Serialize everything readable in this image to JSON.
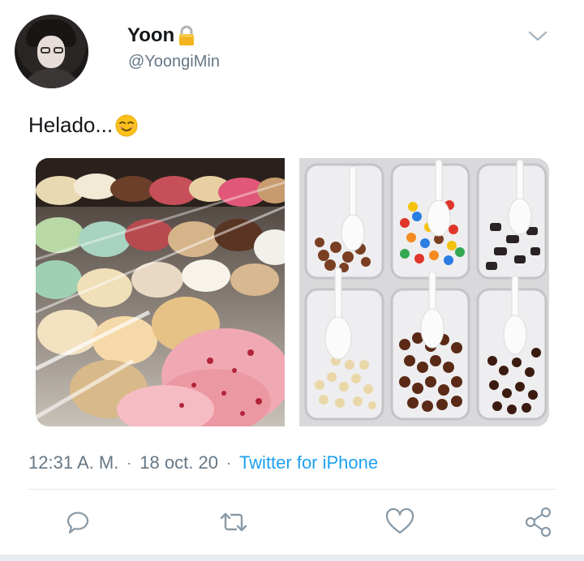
{
  "author": {
    "display_name": "Yoon",
    "handle": "@YoongiMin",
    "protected_icon": "lock-icon",
    "avatar_icon": "profile-photo"
  },
  "menu": {
    "icon": "chevron-down-icon"
  },
  "tweet": {
    "text": "Helado...",
    "emoji": "relieved-face-emoji"
  },
  "media": [
    {
      "name": "ice-cream-gelato-display-photo"
    },
    {
      "name": "toppings-bins-photo"
    }
  ],
  "meta": {
    "time": "12:31 A. M.",
    "separator": "·",
    "date": "18 oct. 20",
    "source": "Twitter for iPhone"
  },
  "actions": [
    {
      "name": "reply-button",
      "icon": "comment-icon"
    },
    {
      "name": "retweet-button",
      "icon": "retweet-icon"
    },
    {
      "name": "like-button",
      "icon": "heart-icon"
    },
    {
      "name": "share-button",
      "icon": "share-icon"
    }
  ],
  "colors": {
    "text": "#14171a",
    "secondary": "#657786",
    "link": "#1da1f2",
    "divider": "#e1e8ed",
    "icon": "#8899a6"
  }
}
